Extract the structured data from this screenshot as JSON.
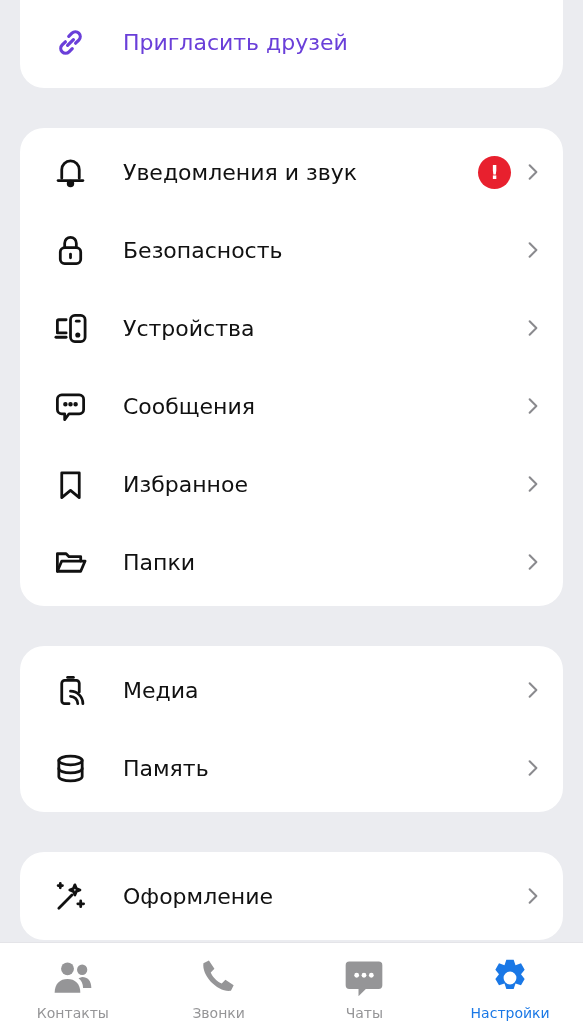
{
  "invite": {
    "label": "Пригласить друзей"
  },
  "sections": [
    {
      "items": [
        {
          "label": "Уведомления и звук",
          "badge": "!"
        },
        {
          "label": "Безопасность"
        },
        {
          "label": "Устройства"
        },
        {
          "label": "Сообщения"
        },
        {
          "label": "Избранное"
        },
        {
          "label": "Папки"
        }
      ]
    },
    {
      "items": [
        {
          "label": "Медиа"
        },
        {
          "label": "Память"
        }
      ]
    },
    {
      "items": [
        {
          "label": "Оформление"
        }
      ]
    }
  ],
  "tab_bar": [
    {
      "label": "Контакты",
      "selected": false
    },
    {
      "label": "Звонки",
      "selected": false
    },
    {
      "label": "Чаты",
      "selected": false
    },
    {
      "label": "Настройки",
      "selected": true
    }
  ]
}
